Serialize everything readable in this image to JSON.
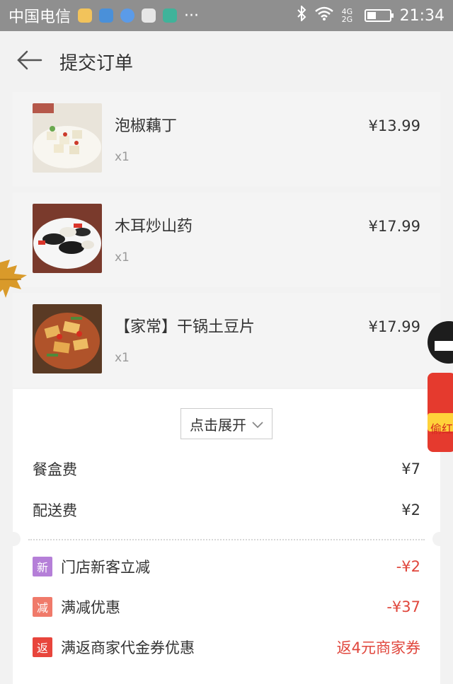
{
  "status_bar": {
    "carrier": "中国电信",
    "signal": "4G 2G",
    "time": "21:34"
  },
  "header": {
    "title": "提交订单"
  },
  "items": [
    {
      "name": "泡椒藕丁",
      "qty": "x1",
      "price": "¥13.99"
    },
    {
      "name": "木耳炒山药",
      "qty": "x1",
      "price": "¥17.99"
    },
    {
      "name": "【家常】干锅土豆片",
      "qty": "x1",
      "price": "¥17.99"
    }
  ],
  "expand_label": "点击展开",
  "fees": [
    {
      "label": "餐盒费",
      "value": "¥7"
    },
    {
      "label": "配送费",
      "value": "¥2"
    }
  ],
  "discounts": [
    {
      "badge": "新",
      "badge_color": "#b57fd8",
      "label": "门店新客立减",
      "value": "-¥2"
    },
    {
      "badge": "减",
      "badge_color": "#f07a6a",
      "label": "满减优惠",
      "value": "-¥37"
    },
    {
      "badge": "返",
      "badge_color": "#e8453c",
      "label": "满返商家代金券优惠",
      "value": "返4元商家券"
    }
  ],
  "floating": {
    "label": "偷红"
  },
  "colors": {
    "accent_red": "#e0463c",
    "status_bar": "#8f8f8f"
  }
}
